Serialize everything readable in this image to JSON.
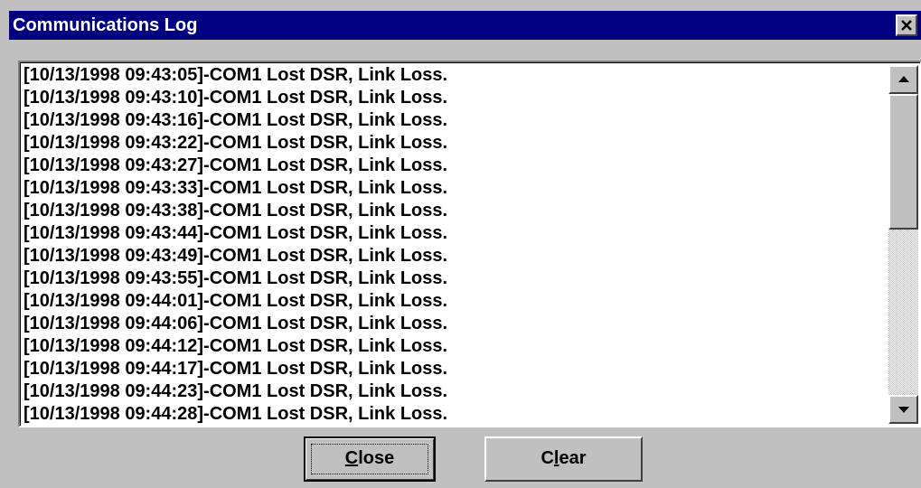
{
  "window": {
    "title": "Communications Log"
  },
  "log": {
    "lines": [
      "[10/13/1998 09:43:05]-COM1 Lost DSR, Link Loss.",
      "[10/13/1998 09:43:10]-COM1 Lost DSR, Link Loss.",
      "[10/13/1998 09:43:16]-COM1 Lost DSR, Link Loss.",
      "[10/13/1998 09:43:22]-COM1 Lost DSR, Link Loss.",
      "[10/13/1998 09:43:27]-COM1 Lost DSR, Link Loss.",
      "[10/13/1998 09:43:33]-COM1 Lost DSR, Link Loss.",
      "[10/13/1998 09:43:38]-COM1 Lost DSR, Link Loss.",
      "[10/13/1998 09:43:44]-COM1 Lost DSR, Link Loss.",
      "[10/13/1998 09:43:49]-COM1 Lost DSR, Link Loss.",
      "[10/13/1998 09:43:55]-COM1 Lost DSR, Link Loss.",
      "[10/13/1998 09:44:01]-COM1 Lost DSR, Link Loss.",
      "[10/13/1998 09:44:06]-COM1 Lost DSR, Link Loss.",
      "[10/13/1998 09:44:12]-COM1 Lost DSR, Link Loss.",
      "[10/13/1998 09:44:17]-COM1 Lost DSR, Link Loss.",
      "[10/13/1998 09:44:23]-COM1 Lost DSR, Link Loss.",
      "[10/13/1998 09:44:28]-COM1 Lost DSR, Link Loss."
    ]
  },
  "buttons": {
    "close": {
      "accel": "C",
      "rest": "lose"
    },
    "clear": {
      "pre": "C",
      "accel": "l",
      "rest": "ear"
    }
  },
  "icons": {
    "title_close": "close-icon",
    "scroll_up": "arrow-up-icon",
    "scroll_down": "arrow-down-icon"
  },
  "colors": {
    "titlebar": "#000080",
    "face": "#c0c0c0",
    "list_bg": "#ffffff"
  }
}
